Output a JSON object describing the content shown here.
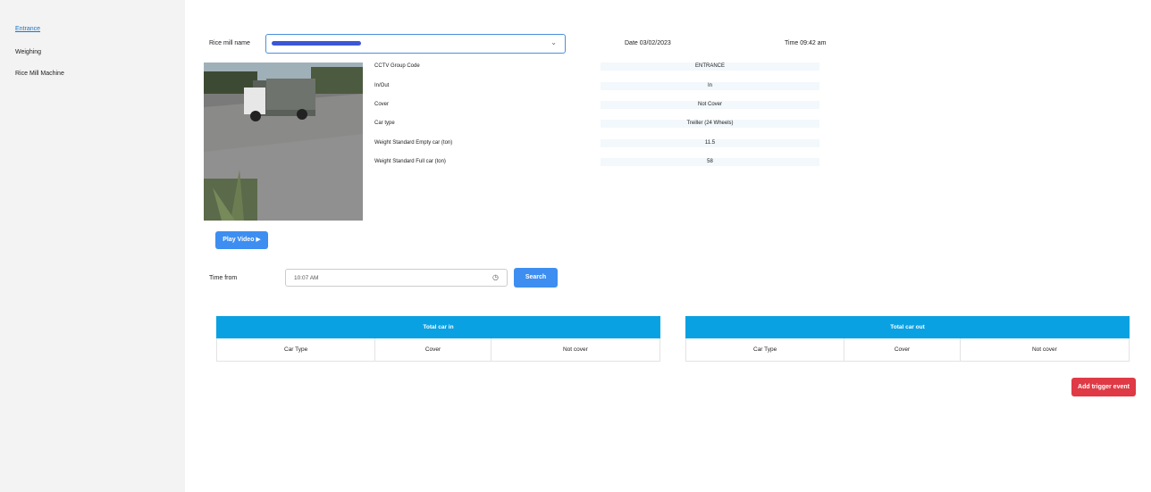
{
  "sidebar": {
    "items": [
      {
        "label": "Entrance",
        "active": true
      },
      {
        "label": "Weighing",
        "active": false
      },
      {
        "label": "Rice Mill Machine",
        "active": false
      }
    ]
  },
  "header": {
    "rice_mill_label": "Rice mill name",
    "date_text": "Date 03/02/2023",
    "time_text": "Time 09:42 am"
  },
  "info": {
    "rows": [
      {
        "label": "CCTV Group Code",
        "value": "ENTRANCE"
      },
      {
        "label": "In/Out",
        "value": "In"
      },
      {
        "label": "Cover",
        "value": "Not Cover"
      },
      {
        "label": "Car type",
        "value": "Treiller (24 Wheels)"
      },
      {
        "label": "Weight Standard Empty car (ton)",
        "value": "11.5"
      },
      {
        "label": "Weight Standard Full car (ton)",
        "value": "58"
      }
    ]
  },
  "controls": {
    "play_video_label": "Play Video ▶",
    "time_from_label": "Time from",
    "time_from_value": "10:07 AM",
    "search_label": "Search"
  },
  "tables": {
    "car_in": {
      "title": "Total car in",
      "columns": [
        "Car Type",
        "Cover",
        "Not cover"
      ]
    },
    "car_out": {
      "title": "Total car out",
      "columns": [
        "Car Type",
        "Cover",
        "Not cover"
      ]
    }
  },
  "actions": {
    "add_trigger_label": "Add trigger event"
  },
  "colors": {
    "accent": "#3d8ef0",
    "table_header": "#0aa1e2",
    "danger": "#df3a45",
    "sidebar_bg": "#f3f3f3"
  }
}
